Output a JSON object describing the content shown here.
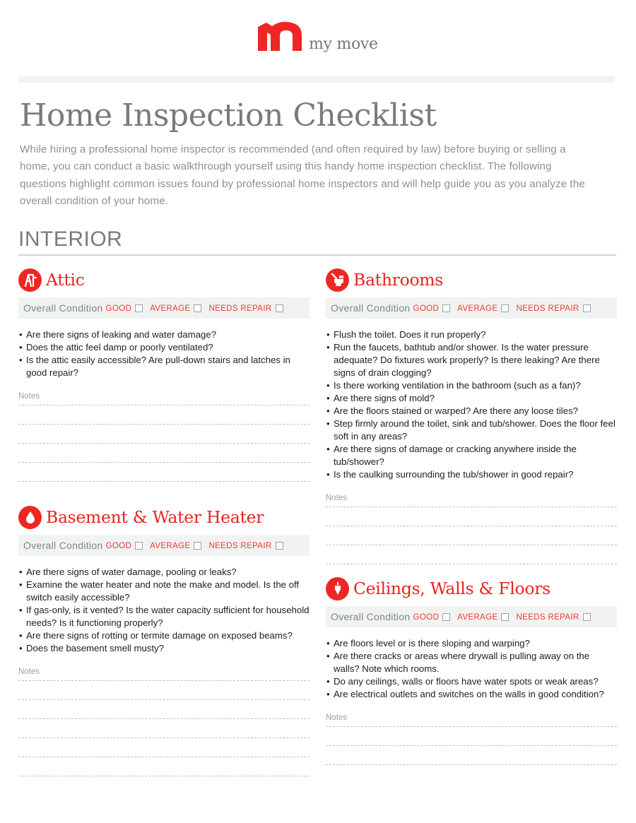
{
  "brand": {
    "name": "my move",
    "accent_color": "#ee2724"
  },
  "document": {
    "title": "Home Inspection Checklist",
    "intro": "While hiring a professional home inspector is recommended (and often required by law) before buying or selling a home, you can conduct a basic walkthrough yourself using this handy home inspection checklist. The following questions highlight common issues found by professional home inspectors and will help guide you as you analyze the overall condition of your home.",
    "section_heading": "INTERIOR"
  },
  "condition": {
    "label": "Overall Condition",
    "options": [
      "GOOD",
      "AVERAGE",
      "NEEDS REPAIR"
    ]
  },
  "notes_label": "Notes",
  "cards": [
    {
      "id": "attic",
      "title": "Attic",
      "icon": "stepladder-icon",
      "questions": [
        "Are there signs of leaking and water damage?",
        "Does the attic feel damp or poorly ventilated?",
        "Is the attic easily accessible? Are pull-down stairs and latches in good repair?"
      ],
      "note_lines": 5
    },
    {
      "id": "bathrooms",
      "title": "Bathrooms",
      "icon": "toilet-icon",
      "questions": [
        "Flush the toilet. Does it run properly?",
        "Run the faucets, bathtub and/or shower. Is the water pressure adequate? Do fixtures work properly? Is there leaking? Are there signs of drain clogging?",
        "Is there working ventilation in the bathroom (such as a fan)?",
        "Are there signs of mold?",
        "Are the floors stained or warped? Are there any loose tiles?",
        "Step firmly around the toilet, sink and tub/shower. Does the floor feel soft in any areas?",
        "Are there signs of damage or cracking anywhere inside the tub/shower?",
        "Is the caulking surrounding the tub/shower in good repair?"
      ],
      "note_lines": 4
    },
    {
      "id": "basement",
      "title": "Basement & Water Heater",
      "icon": "water-drop-icon",
      "questions": [
        "Are there signs of water damage, pooling or leaks?",
        "Examine the water heater and note the make and model. Is the off switch easily accessible?",
        "If gas-only, is it vented? Is the water capacity sufficient for household needs? Is it functioning properly?",
        "Are there signs of rotting or termite damage on exposed beams?",
        "Does the basement smell musty?"
      ],
      "note_lines": 6
    },
    {
      "id": "ceilings",
      "title": "Ceilings, Walls & Floors",
      "icon": "plumb-bob-icon",
      "questions": [
        "Are floors level or is there sloping and warping?",
        "Are there cracks or areas where drywall is pulling away on the walls? Note which rooms.",
        "Do any ceilings, walls or floors have water spots or weak areas?",
        "Are electrical outlets and switches on the walls in good condition?"
      ],
      "note_lines": 3
    }
  ]
}
